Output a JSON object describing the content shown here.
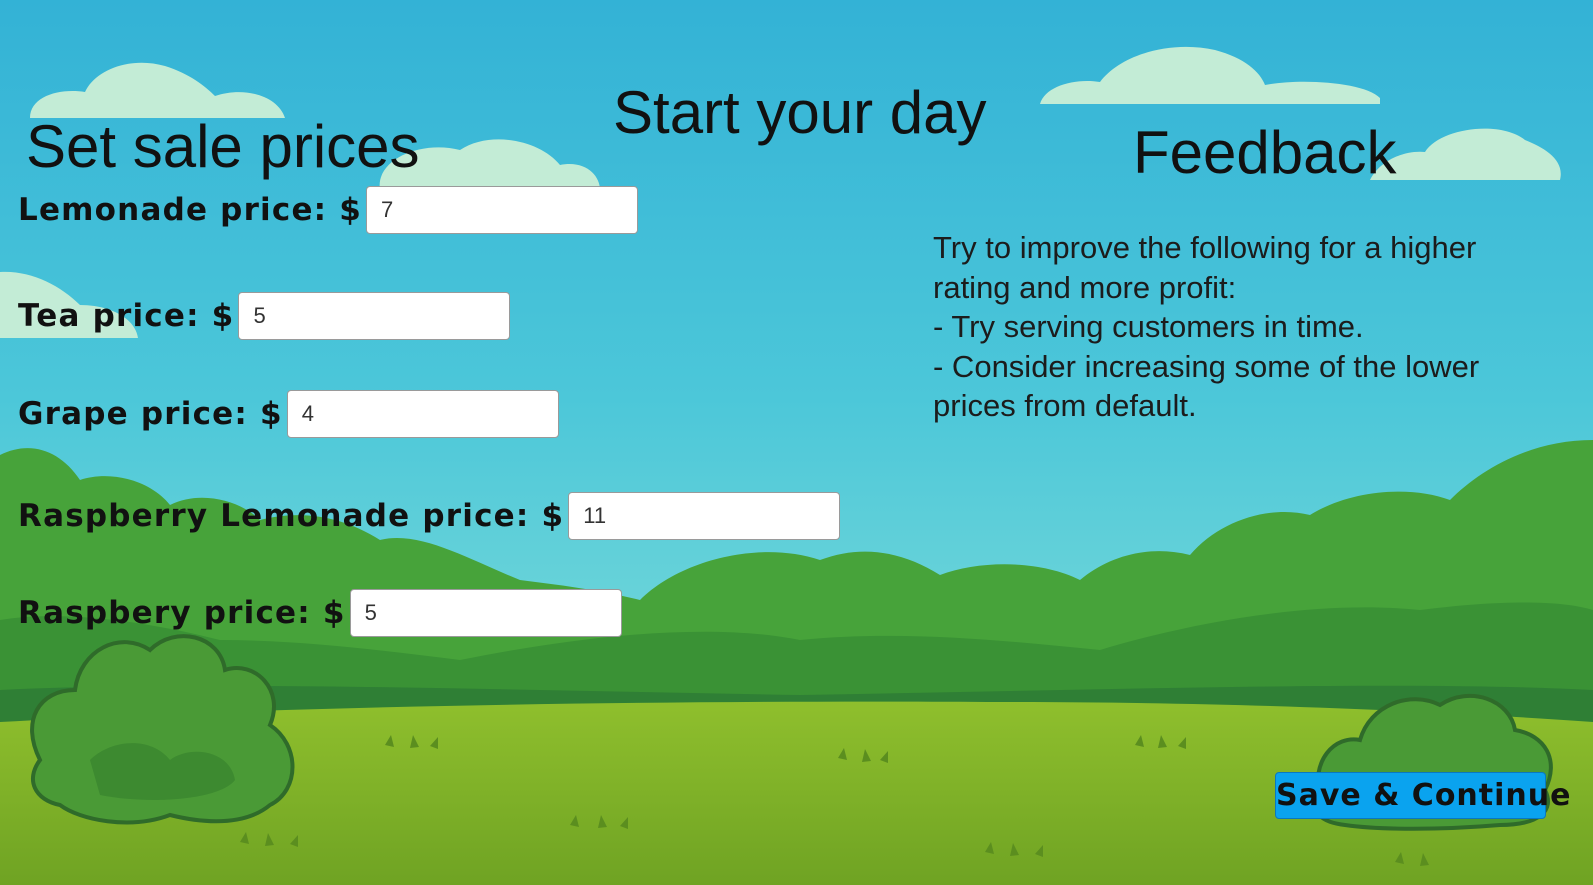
{
  "title": "Start your day",
  "prices_panel": {
    "heading": "Set sale prices",
    "rows": [
      {
        "label": "Lemonade price: $",
        "value": "7"
      },
      {
        "label": "Tea price: $",
        "value": "5"
      },
      {
        "label": "Grape price: $",
        "value": "4"
      },
      {
        "label": "Raspberry Lemonade price: $",
        "value": "11"
      },
      {
        "label": "Raspbery price: $",
        "value": "5"
      }
    ]
  },
  "feedback_panel": {
    "heading": "Feedback",
    "lines": [
      "Try to improve the following for a higher",
      "rating and more profit:",
      "- Try serving customers in time.",
      "- Consider increasing some of the lower",
      "prices from default."
    ]
  },
  "save_button": {
    "label": "Save & Continue"
  },
  "colors": {
    "sky_top": "#35b5d6",
    "sky_bottom": "#7fe0da",
    "grass": "#86b92b",
    "button": "#0aa3ef"
  }
}
